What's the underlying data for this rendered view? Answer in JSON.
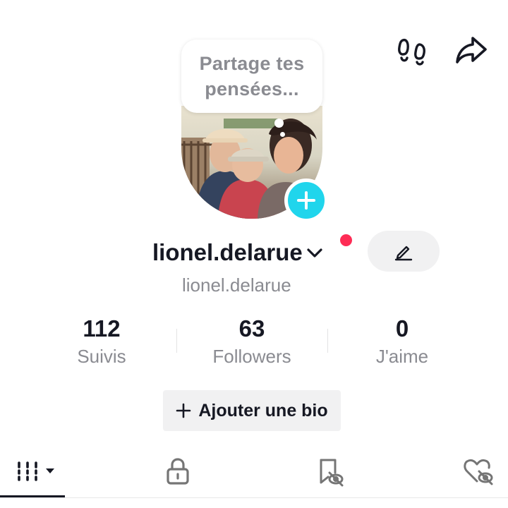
{
  "header": {
    "footprints_icon": "footprints-icon",
    "share_icon": "share-arrow-icon"
  },
  "profile": {
    "thought_bubble": "Partage tes\npensées...",
    "username": "lionel.delarue",
    "handle": "lionel.delarue",
    "edit_icon": "pencil-icon",
    "notification_color": "#fe2c55",
    "add_button_color": "#20d5ec"
  },
  "stats": [
    {
      "value": "112",
      "label": "Suivis"
    },
    {
      "value": "63",
      "label": "Followers"
    },
    {
      "value": "0",
      "label": "J'aime"
    }
  ],
  "bio_button": {
    "label": "Ajouter une bio",
    "icon": "plus-icon"
  },
  "tabs": [
    {
      "icon": "grid-videos-icon",
      "active": true
    },
    {
      "icon": "lock-icon",
      "active": false
    },
    {
      "icon": "bookmark-hidden-icon",
      "active": false
    },
    {
      "icon": "heart-hidden-icon",
      "active": false
    }
  ]
}
